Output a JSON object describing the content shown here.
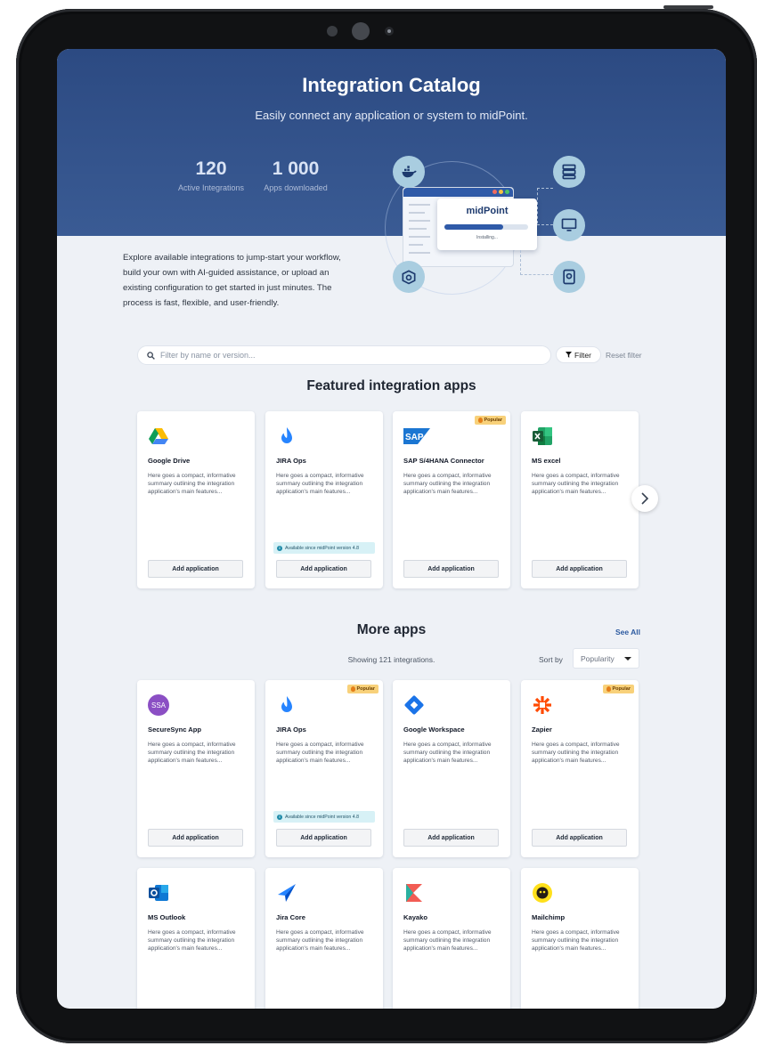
{
  "hero": {
    "title": "Integration Catalog",
    "subtitle": "Easily connect any application or system to midPoint.",
    "stats": [
      {
        "value": "120",
        "label": "Active Integrations"
      },
      {
        "value": "1 000",
        "label": "Apps downloaded"
      }
    ],
    "illustration": {
      "logo": "midPoint",
      "status": "Installing...",
      "progress": 0.7,
      "icons": [
        "docker-icon",
        "server-icon",
        "monitor-icon",
        "storage-icon",
        "package-gear-icon"
      ]
    }
  },
  "intro_text": "Explore available integrations to jump-start your workflow, build your own with AI-guided assistance, or upload an existing configuration to get started in just minutes. The process is fast, flexible, and user-friendly.",
  "search": {
    "placeholder": "Filter by name or version...",
    "value": ""
  },
  "filter_label": "Filter",
  "reset_label": "Reset filter",
  "featured": {
    "title": "Featured integration apps",
    "cards": [
      {
        "name": "Google Drive",
        "logo": "google-drive-icon",
        "desc": "Here goes a compact, informative summary outlining the integration application's main features...",
        "popular": false,
        "availability": "",
        "button": "Add application"
      },
      {
        "name": "JIRA Ops",
        "logo": "jira-ops-icon",
        "desc": "Here goes a compact, informative summary outlining the integration application's main features...",
        "popular": false,
        "availability": "Available since midPoint version 4.8",
        "button": "Add application"
      },
      {
        "name": "SAP S/4HANA Connector",
        "logo": "sap-icon",
        "desc": "Here goes a compact, informative summary outlining the integration application's main features...",
        "popular": true,
        "availability": "",
        "button": "Add application"
      },
      {
        "name": "MS excel",
        "logo": "excel-icon",
        "desc": "Here goes a compact, informative summary outlining the integration application's main features...",
        "popular": false,
        "availability": "",
        "button": "Add application"
      }
    ]
  },
  "popular_label": "Popular",
  "more": {
    "title": "More apps",
    "see_all": "See All",
    "showing": "Showing 121 integrations.",
    "sort_label": "Sort by",
    "sort_value": "Popularity",
    "cards": [
      {
        "name": "SecureSync App",
        "logo": "ssa-icon",
        "logo_text": "SSA",
        "desc": "Here goes a compact, informative summary outlining the integration application's main features...",
        "popular": false,
        "availability": "",
        "button": "Add application"
      },
      {
        "name": "JIRA Ops",
        "logo": "jira-ops-icon",
        "desc": "Here goes a compact, informative summary outlining the integration application's main features...",
        "popular": true,
        "availability": "Available since midPoint version 4.8",
        "button": "Add application"
      },
      {
        "name": "Google Workspace",
        "logo": "google-workspace-icon",
        "desc": "Here goes a compact, informative summary outlining the integration application's main features...",
        "popular": false,
        "availability": "",
        "button": "Add application"
      },
      {
        "name": "Zapier",
        "logo": "zapier-icon",
        "desc": "Here goes a compact, informative summary outlining the integration application's main features...",
        "popular": true,
        "availability": "",
        "button": "Add application"
      },
      {
        "name": "MS Outlook",
        "logo": "outlook-icon",
        "desc": "Here goes a compact, informative summary outlining the integration application's main features...",
        "popular": false,
        "availability": "",
        "button": ""
      },
      {
        "name": "Jira Core",
        "logo": "jira-core-icon",
        "desc": "Here goes a compact, informative summary outlining the integration application's main features...",
        "popular": false,
        "availability": "",
        "button": ""
      },
      {
        "name": "Kayako",
        "logo": "kayako-icon",
        "desc": "Here goes a compact, informative summary outlining the integration application's main features...",
        "popular": false,
        "availability": "",
        "button": ""
      },
      {
        "name": "Mailchimp",
        "logo": "mailchimp-icon",
        "desc": "Here goes a compact, informative summary outlining the integration application's main features...",
        "popular": false,
        "availability": "",
        "button": ""
      }
    ]
  },
  "colors": {
    "hero": "#2c4a82",
    "accent": "#2f5aa8",
    "popular_badge": "#f8d17a",
    "availability": "#d7f1f6"
  }
}
